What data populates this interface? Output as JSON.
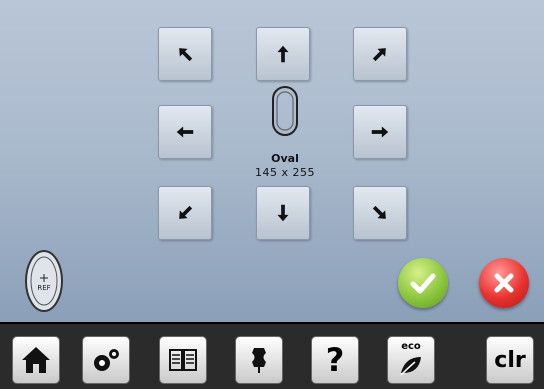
{
  "hoop": {
    "name": "Oval",
    "size": "145 x 255"
  },
  "ref_button": {
    "label": "REF"
  },
  "taskbar": {
    "help_label": "?",
    "eco_label": "eco",
    "clear_label": "clr"
  },
  "colors": {
    "confirm": "#8cc63f",
    "cancel": "#e8322f",
    "taskbar": "#2b2b2b"
  },
  "icons": [
    "arrow-up-left-icon",
    "arrow-up-icon",
    "arrow-up-right-icon",
    "arrow-left-icon",
    "arrow-right-icon",
    "arrow-down-left-icon",
    "arrow-down-icon",
    "arrow-down-right-icon",
    "oval-hoop-icon",
    "ref-hoop-icon",
    "checkmark-icon",
    "close-icon",
    "home-icon",
    "gears-icon",
    "book-icon",
    "dress-form-icon",
    "help-icon",
    "eco-leaf-icon"
  ]
}
